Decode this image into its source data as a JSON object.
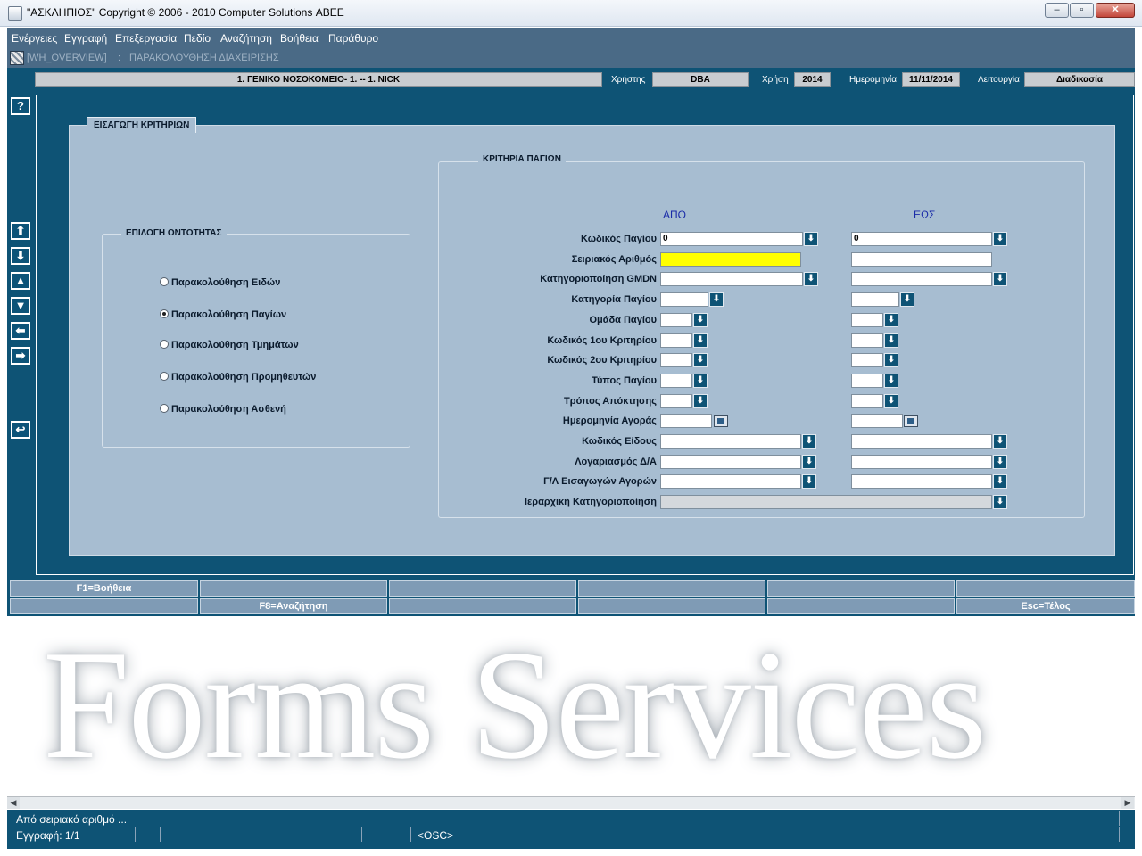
{
  "window": {
    "title": "\"ΑΣΚΛΗΠΙΟΣ\" Copyright © 2006 - 2010 Computer Solutions ΑΒΕΕ",
    "controls": [
      "minimize",
      "restore",
      "close"
    ]
  },
  "menubar": [
    "Ενέργειες",
    "Εγγραφή",
    "Επεξεργασία",
    "Πεδίο",
    "Αναζήτηση",
    "Βοήθεια",
    "Παράθυρο"
  ],
  "form_window": {
    "name": "[WH_OVERVIEW]",
    "separator": ":",
    "title": "ΠΑΡΑΚΟΛΟΥΘΗΣΗ ΔΙΑΧΕΙΡΙΣΗΣ"
  },
  "header": {
    "hospital": "1. ΓΕΝΙΚΟ ΝΟΣΟΚΟΜΕΙΟ- 1. -- 1. NICK",
    "user_label": "Χρήστης",
    "user": "DBA",
    "year_label": "Χρήση",
    "year": "2014",
    "date_label": "Ημερομηνία",
    "date": "11/11/2014",
    "function_label": "Λειτουργία",
    "function": "Διαδικασία"
  },
  "side_toolbar": {
    "help": "?",
    "buttons": [
      "first-icon",
      "last-icon",
      "previous-icon",
      "next-icon",
      "back-icon",
      "forward-icon",
      "exit-icon"
    ]
  },
  "panel_tab": "ΕΙΣΑΓΩΓΗ ΚΡΙΤΗΡΙΩΝ",
  "entity_group": {
    "title": "ΕΠΙΛΟΓΗ ΟΝΤΟΤΗΤΑΣ",
    "options": [
      {
        "label": "Παρακολούθηση Ειδών",
        "selected": false
      },
      {
        "label": "Παρακολούθηση Παγίων",
        "selected": true
      },
      {
        "label": "Παρακολούθηση Τμημάτων",
        "selected": false
      },
      {
        "label": "Παρακολούθηση Προμηθευτών",
        "selected": false
      },
      {
        "label": "Παρακολούθηση Ασθενή",
        "selected": false
      }
    ]
  },
  "criteria_group": {
    "title": "ΚΡΙΤΗΡΙΑ ΠΑΓΙΩΝ",
    "from_label": "ΑΠΟ",
    "to_label": "ΕΩΣ",
    "rows": [
      {
        "label": "Κωδικός Παγίου",
        "from": "0",
        "to": "0"
      },
      {
        "label": "Σειριακός Αριθμός",
        "from": "",
        "to": ""
      },
      {
        "label": "Κατηγοριοποίηση GMDN",
        "from": "",
        "to": ""
      },
      {
        "label": "Κατηγορία Παγίου",
        "from": "",
        "to": ""
      },
      {
        "label": "Ομάδα Παγίου",
        "from": "",
        "to": ""
      },
      {
        "label": "Κωδικός 1ου Κριτηρίου",
        "from": "",
        "to": ""
      },
      {
        "label": "Κωδικός 2ου Κριτηρίου",
        "from": "",
        "to": ""
      },
      {
        "label": "Τύπος Παγίου",
        "from": "",
        "to": ""
      },
      {
        "label": "Τρόπος Απόκτησης",
        "from": "",
        "to": ""
      },
      {
        "label": "Ημερομηνία Αγοράς",
        "from": "",
        "to": ""
      },
      {
        "label": "Κωδικός Είδους",
        "from": "",
        "to": ""
      },
      {
        "label": "Λογαριασμός Δ/Α",
        "from": "",
        "to": ""
      },
      {
        "label": "Γ/Λ Εισαγωγών Αγορών",
        "from": "",
        "to": ""
      },
      {
        "label": "Ιεραρχική Κατηγοριοποίηση",
        "value": ""
      }
    ]
  },
  "function_keys": {
    "row1": [
      "F1=Βοήθεια",
      "",
      "",
      "",
      "",
      ""
    ],
    "row2": [
      "",
      "F8=Αναζήτηση",
      "",
      "",
      "",
      "Esc=Τέλος"
    ]
  },
  "watermark": "Forms Services",
  "status": {
    "message": "Από σειριακό αριθμό ...",
    "record": "Εγγραφή: 1/1",
    "mode": "<OSC>"
  },
  "colors": {
    "form_background": "#0e5375",
    "panel": "#a7bdd1",
    "highlight_field": "#ffff00",
    "column_heading": "#1a2ba8"
  }
}
